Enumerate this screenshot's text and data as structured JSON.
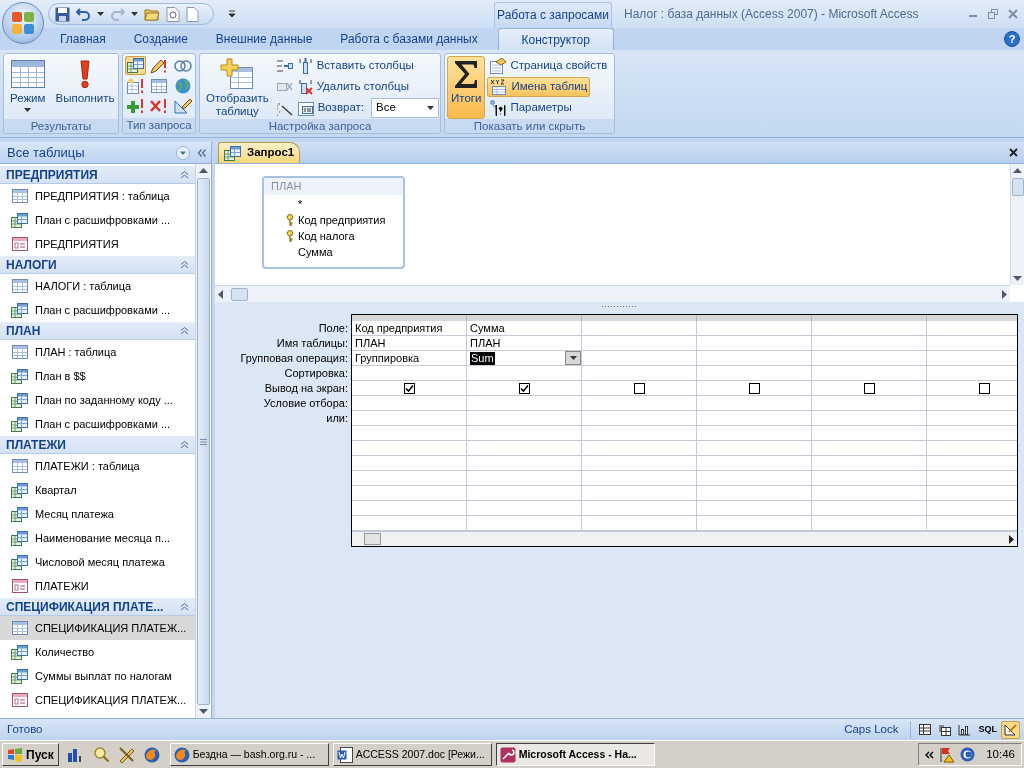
{
  "title_bar": {
    "context_tab": "Работа с запросами",
    "title": "Налог : база данных (Access 2007) - Microsoft Access"
  },
  "ribbon_tabs": [
    {
      "label": "Главная",
      "selected": false
    },
    {
      "label": "Создание",
      "selected": false
    },
    {
      "label": "Внешние данные",
      "selected": false
    },
    {
      "label": "Работа с базами данных",
      "selected": false
    },
    {
      "label": "Конструктор",
      "selected": true
    }
  ],
  "help_button": "?",
  "ribbon_groups": [
    {
      "label": "Результаты",
      "items": [
        {
          "kind": "large",
          "label": "Режим",
          "dropdown": true
        },
        {
          "kind": "large",
          "label": "Выполнить"
        }
      ]
    },
    {
      "label": "Тип запроса",
      "items": [
        {
          "kind": "icon_grid",
          "buttons": [
            {
              "selected": true
            },
            {
              "selected": false
            },
            {
              "selected": false
            },
            {
              "selected": false
            },
            {
              "selected": false
            },
            {
              "selected": false
            },
            {
              "selected": false
            },
            {
              "selected": false
            },
            {
              "selected": false
            }
          ]
        }
      ]
    },
    {
      "label": "Настройка запроса",
      "items": [
        {
          "kind": "large",
          "label": "Отобразить таблицу"
        },
        {
          "kind": "stack",
          "side_icons": true,
          "rows": [
            {
              "label": "Вставить столбцы"
            },
            {
              "label": "Удалить столбцы"
            },
            {
              "label": "Возврат:",
              "value": "Все"
            }
          ]
        }
      ]
    },
    {
      "label": "Показать или скрыть",
      "items": [
        {
          "kind": "large",
          "label": "Итоги",
          "selected": true
        },
        {
          "kind": "stack",
          "rows": [
            {
              "label": "Страница свойств",
              "selected": false
            },
            {
              "label": "Имена таблиц",
              "selected": true
            },
            {
              "label": "Параметры",
              "selected": false
            }
          ]
        }
      ]
    }
  ],
  "nav": {
    "title": "Все таблицы",
    "groups": [
      {
        "label": "ПРЕДПРИЯТИЯ",
        "items": [
          {
            "label": "ПРЕДПРИЯТИЯ : таблица",
            "kind": "table",
            "selected": false
          },
          {
            "label": "План с расшифровками ...",
            "kind": "query",
            "selected": false
          },
          {
            "label": "ПРЕДПРИЯТИЯ",
            "kind": "form",
            "selected": false
          }
        ]
      },
      {
        "label": "НАЛОГИ",
        "items": [
          {
            "label": "НАЛОГИ : таблица",
            "kind": "table",
            "selected": false
          },
          {
            "label": "План с расшифровками ...",
            "kind": "query",
            "selected": false
          }
        ]
      },
      {
        "label": "ПЛАН",
        "items": [
          {
            "label": "ПЛАН : таблица",
            "kind": "table",
            "selected": false
          },
          {
            "label": "План в $$",
            "kind": "query",
            "selected": false
          },
          {
            "label": "План по заданному коду ...",
            "kind": "query",
            "selected": false
          },
          {
            "label": "План с расшифровками ...",
            "kind": "query",
            "selected": false
          }
        ]
      },
      {
        "label": "ПЛАТЕЖИ",
        "items": [
          {
            "label": "ПЛАТЕЖИ : таблица",
            "kind": "table",
            "selected": false
          },
          {
            "label": "Квартал",
            "kind": "query",
            "selected": false
          },
          {
            "label": "Месяц платежа",
            "kind": "query",
            "selected": false
          },
          {
            "label": "Наименование месяца п...",
            "kind": "query",
            "selected": false
          },
          {
            "label": "Числовой месяц платежа",
            "kind": "query",
            "selected": false
          },
          {
            "label": "ПЛАТЕЖИ",
            "kind": "form",
            "selected": false
          }
        ]
      },
      {
        "label": "СПЕЦИФИКАЦИЯ ПЛАТЕ...",
        "items": [
          {
            "label": "СПЕЦИФИКАЦИЯ ПЛАТЕЖ...",
            "kind": "table",
            "selected": true
          },
          {
            "label": "Количество",
            "kind": "query",
            "selected": false
          },
          {
            "label": "Суммы выплат по налогам",
            "kind": "query",
            "selected": false
          },
          {
            "label": "СПЕЦИФИКАЦИЯ ПЛАТЕЖ...",
            "kind": "form",
            "selected": false
          }
        ]
      }
    ]
  },
  "document": {
    "tabs": [
      {
        "label": "Запрос1",
        "selected": true
      }
    ],
    "field_list": {
      "title": "ПЛАН",
      "fields": [
        {
          "label": "*",
          "key": false
        },
        {
          "label": "Код предприятия",
          "key": true
        },
        {
          "label": "Код налога",
          "key": true
        },
        {
          "label": "Сумма",
          "key": false
        }
      ]
    },
    "grid": {
      "row_labels": [
        "Поле:",
        "Имя таблицы:",
        "Групповая операция:",
        "Сортировка:",
        "Вывод на экран:",
        "Условие отбора:",
        "или:"
      ],
      "columns": [
        {
          "field": "Код предприятия",
          "table": "ПЛАН",
          "total": "Группировка",
          "show": true
        },
        {
          "field": "Сумма",
          "table": "ПЛАН",
          "total": "Sum",
          "editing": true,
          "show": true
        },
        {
          "show": false
        },
        {
          "show": false
        },
        {
          "show": false
        },
        {
          "show": false
        }
      ]
    }
  },
  "status_bar": {
    "text": "Готово",
    "indicator": "Caps Lock",
    "views": [
      {
        "kind": "datasheet",
        "selected": false
      },
      {
        "kind": "pivot_table",
        "selected": false
      },
      {
        "kind": "pivot_chart",
        "selected": false
      },
      {
        "kind": "sql",
        "label": "SQL",
        "selected": false
      },
      {
        "kind": "design",
        "selected": true
      }
    ]
  },
  "taskbar": {
    "start": "Пуск",
    "tasks": [
      {
        "label": "Бездна — bash.org.ru - ...",
        "kind": "browser",
        "selected": false
      },
      {
        "label": "ACCESS 2007.doc [Режи...",
        "kind": "word",
        "selected": false
      },
      {
        "label": "Microsoft Access - На...",
        "kind": "access",
        "selected": true
      }
    ],
    "clock": "10:46"
  }
}
